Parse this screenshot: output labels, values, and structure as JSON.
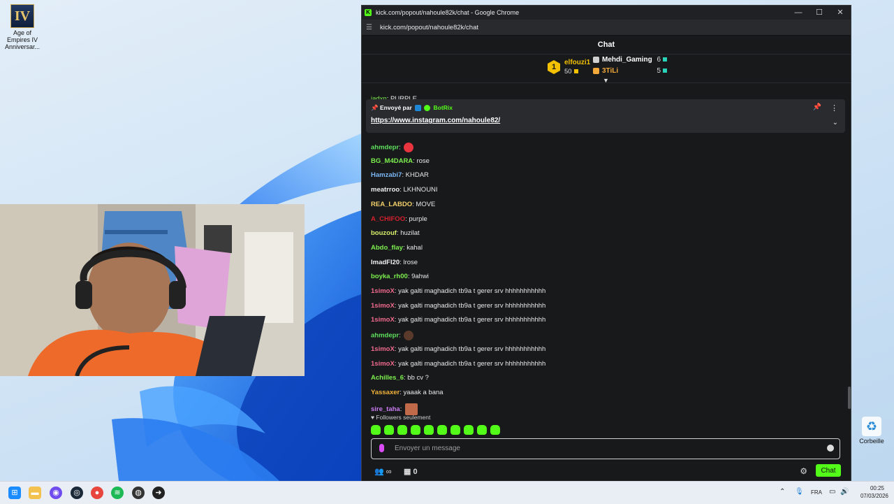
{
  "desktop": {
    "icons": [
      {
        "label": "Age of Empires IV Anniversar...",
        "glyph": "IV"
      },
      {
        "label": "Corbeille",
        "glyph": "♻"
      }
    ]
  },
  "window": {
    "title": "kick.com/popout/nahoule82k/chat - Google Chrome",
    "url": "kick.com/popout/nahoule82k/chat",
    "minimize_glyph": "—",
    "maximize_glyph": "☐",
    "close_glyph": "✕"
  },
  "chat": {
    "header": "Chat",
    "leaderboard": {
      "first": {
        "rank": "1",
        "name": "elfouzi1",
        "count": "50"
      },
      "second": {
        "name": "Mehdi_Gaming",
        "count": "6"
      },
      "third": {
        "name": "3TiLi",
        "count": "5"
      }
    },
    "cut_message": {
      "user": "jadxn",
      "text": "PURPLE"
    },
    "pinned": {
      "prefix": "Envoyé par",
      "sender": "BotRix",
      "link": "https://www.instagram.com/nahoule82/"
    },
    "messages": [
      {
        "user": "ahmdepr",
        "text": "",
        "color": "#5ee05e",
        "emote": "#e8343f"
      },
      {
        "user": "BG_M4DARA",
        "text": "rose",
        "color": "#7df04f"
      },
      {
        "user": "Hamzabi7",
        "text": "KHDAR",
        "color": "#7ab8f5"
      },
      {
        "user": "meatrroo",
        "text": "LKHNOUNI",
        "color": "#f0f0f0"
      },
      {
        "user": "REA_LABDO",
        "text": "MOVE",
        "color": "#f3d06a"
      },
      {
        "user": "A_CHIFOO",
        "text": "purple",
        "color": "#d3202d"
      },
      {
        "user": "bouzouf",
        "text": "huzilat",
        "color": "#d6f06a"
      },
      {
        "user": "Abdo_flay",
        "text": "kahal",
        "color": "#7df04f"
      },
      {
        "user": "ImadFI20",
        "text": "lrose",
        "color": "#f0f0f0"
      },
      {
        "user": "boyka_rh00",
        "text": "9ahwi",
        "color": "#7df04f"
      },
      {
        "user": "1simoX",
        "text": "yak galti maghadich tb9a t gerer srv hhhhhhhhhhh",
        "color": "#f06a8e"
      },
      {
        "user": "1simoX",
        "text": "yak galti maghadich tb9a t gerer srv hhhhhhhhhhh",
        "color": "#f06a8e"
      },
      {
        "user": "1simoX",
        "text": "yak galti maghadich tb9a t gerer srv hhhhhhhhhhh",
        "color": "#f06a8e"
      },
      {
        "user": "ahmdepr",
        "text": "",
        "color": "#5ee05e",
        "emote": "#5a3a2a"
      },
      {
        "user": "1simoX",
        "text": "yak galti maghadich tb9a t gerer srv hhhhhhhhhhh",
        "color": "#f06a8e"
      },
      {
        "user": "1simoX",
        "text": "yak galti maghadich tb9a t gerer srv hhhhhhhhhhh",
        "color": "#f06a8e"
      },
      {
        "user": "Achilles_6",
        "text": "bb cv ?",
        "color": "#7df04f"
      },
      {
        "user": "Yassaxer",
        "text": "yaaak a bana",
        "color": "#f3b33a"
      },
      {
        "user": "sire_taha",
        "text": "",
        "color": "#c97cf0",
        "emote": "#c06a4a",
        "emote_square": true
      }
    ],
    "followers_only": "Followers seulement",
    "input_placeholder": "Envoyer un message",
    "footer": {
      "users_glyph": "∞",
      "store_count": "0",
      "send_label": "Chat"
    }
  },
  "taskbar": {
    "language": "FRA",
    "time": "00:25",
    "date": "07/03/2026"
  },
  "colors": {
    "accent": "#53fc18",
    "chat_bg": "#18191b",
    "gold": "#f3c100"
  }
}
